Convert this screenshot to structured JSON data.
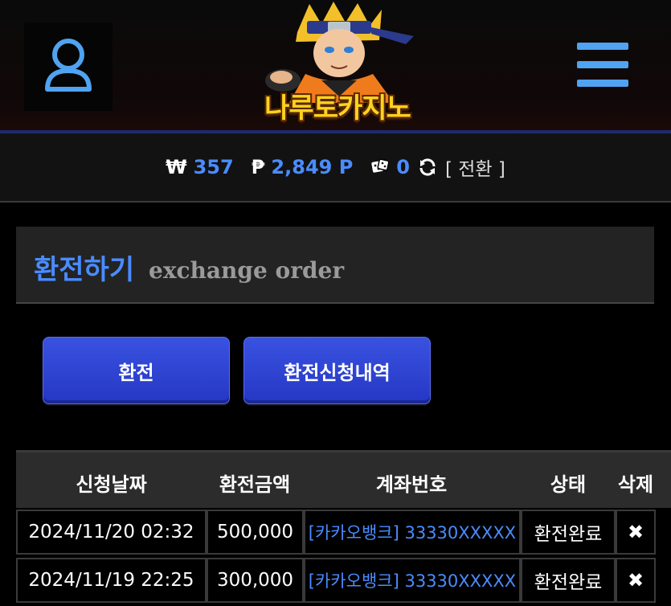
{
  "header": {
    "logo_text": "나루토카지노",
    "user_icon": "user-icon",
    "menu_icon": "hamburger-menu-icon"
  },
  "balance": {
    "won_symbol": "₩",
    "won_value": "357",
    "point_symbol": "₱",
    "point_value": "2,849 P",
    "dice_value": "0",
    "convert_label": "[ 전환 ]"
  },
  "section": {
    "title_ko": "환전하기",
    "title_en": "exchange order"
  },
  "buttons": {
    "exchange": "환전",
    "history": "환전신청내역"
  },
  "table": {
    "headers": [
      "신청날짜",
      "환전금액",
      "계좌번호",
      "상태",
      "삭제"
    ],
    "rows": [
      {
        "date": "2024/11/20 02:32",
        "amount": "500,000",
        "account": "[카카오뱅크] 33330XXXXX",
        "status": "환전완료",
        "delete": "✖"
      },
      {
        "date": "2024/11/19 22:25",
        "amount": "300,000",
        "account": "[카카오뱅크] 33330XXXXX",
        "status": "환전완료",
        "delete": "✖"
      }
    ]
  },
  "colors": {
    "accent": "#4a8cff",
    "button": "#2f45d6",
    "logo": "#ffd21f"
  }
}
